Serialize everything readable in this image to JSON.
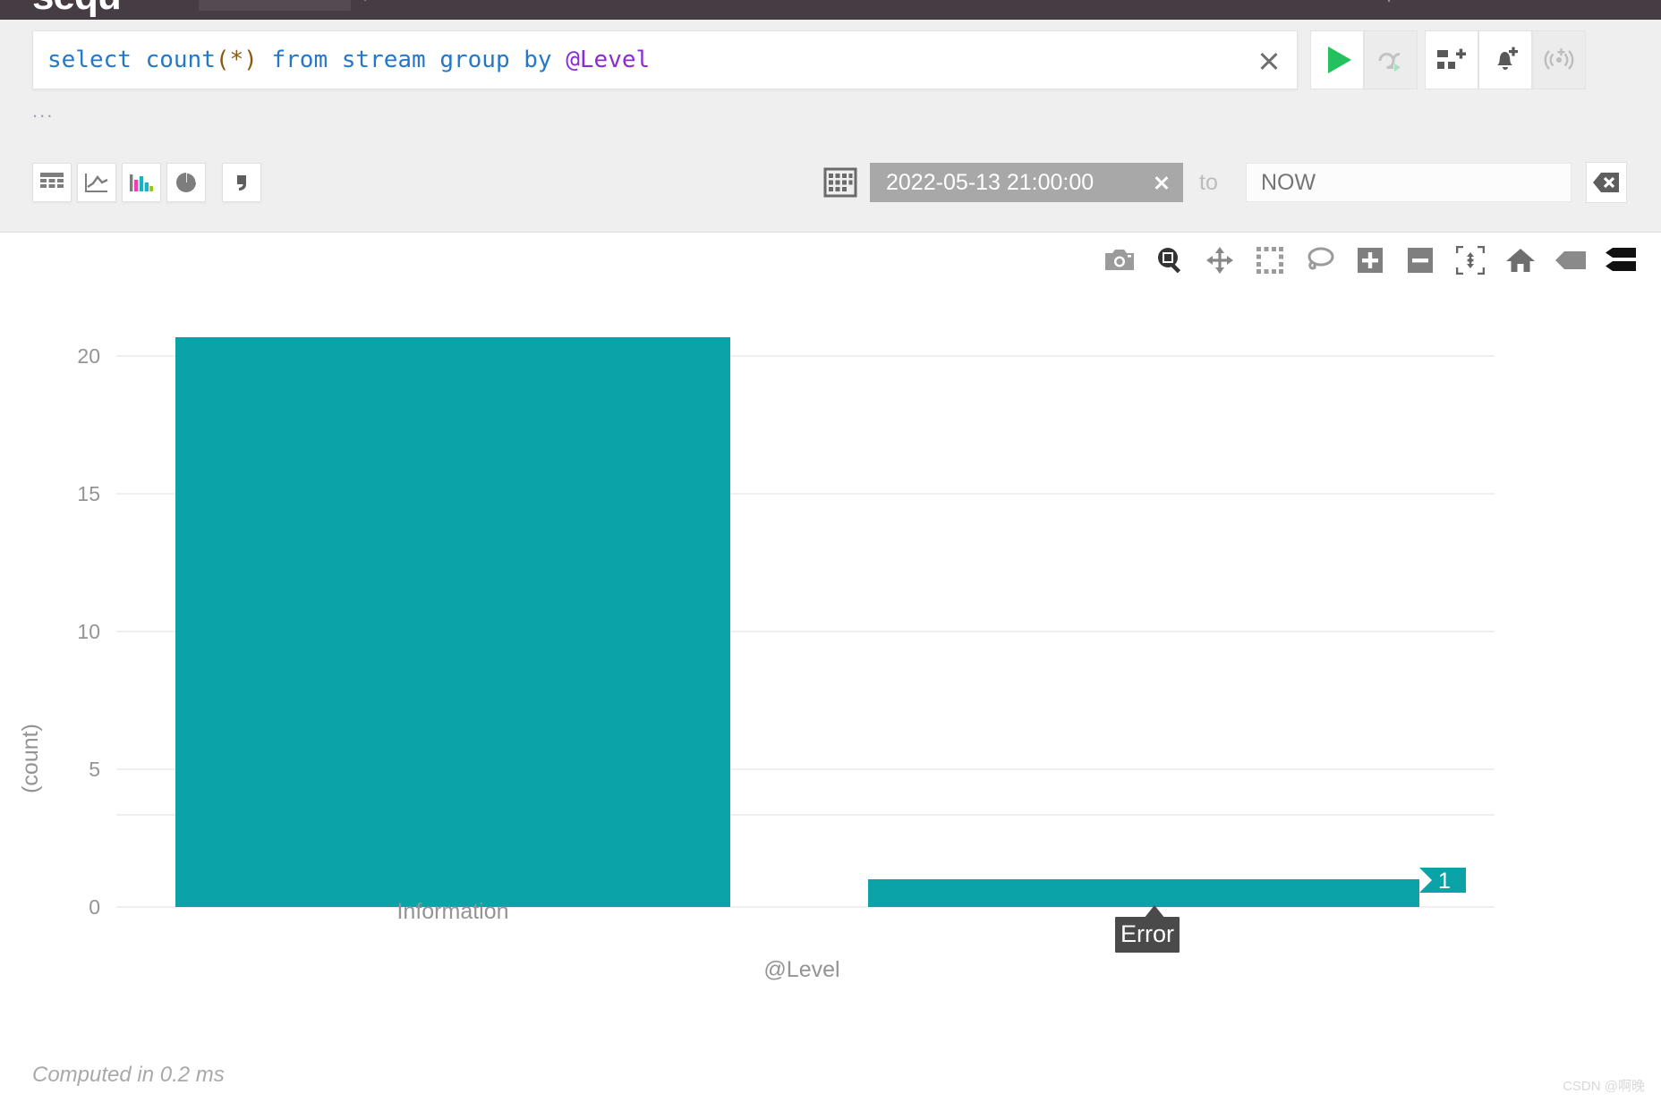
{
  "app": {
    "logo_text": "sequ",
    "top_bar_color": "#453c44",
    "accent_color": "#0ca3a8"
  },
  "query": {
    "full_text": "select count(*) from stream group by @Level",
    "tokens": {
      "select": "select",
      "count": "count",
      "paren_open": "(",
      "star": "*",
      "paren_close": ")",
      "from": "from",
      "stream": "stream",
      "group": "group",
      "by": "by",
      "level": "@Level"
    },
    "clear_icon": "close-icon",
    "ellipsis": "...",
    "buttons": [
      {
        "name": "run-query-button",
        "icon": "play-icon",
        "state": "enabled"
      },
      {
        "name": "live-tail-button",
        "icon": "repeat-play-icon",
        "state": "disabled"
      },
      {
        "name": "add-to-dashboard-button",
        "icon": "dashboard-add-icon",
        "state": "enabled"
      },
      {
        "name": "create-alert-button",
        "icon": "bell-add-icon",
        "state": "enabled"
      },
      {
        "name": "create-signal-button",
        "icon": "broadcast-add-icon",
        "state": "disabled"
      }
    ]
  },
  "viz_toolbar": {
    "items": [
      {
        "name": "view-table-button",
        "icon": "table-icon",
        "active": false
      },
      {
        "name": "view-line-chart-button",
        "icon": "line-chart-icon",
        "active": false
      },
      {
        "name": "view-bar-chart-button",
        "icon": "bar-chart-icon",
        "active": true
      },
      {
        "name": "view-pie-chart-button",
        "icon": "pie-chart-icon",
        "active": false
      },
      {
        "name": "view-raw-button",
        "icon": "comma-icon",
        "active": false
      }
    ]
  },
  "time_range": {
    "calendar_icon": "calendar-icon",
    "from_value": "2022-05-13 21:00:00",
    "from_clear_icon": "close-icon",
    "to_label": "to",
    "to_value": "",
    "to_placeholder": "NOW",
    "clear_all_icon": "backspace-icon"
  },
  "modebar": {
    "items": [
      {
        "name": "download-plot-button",
        "icon": "camera-icon",
        "active": false
      },
      {
        "name": "zoom-tool-button",
        "icon": "zoom-magnifier-icon",
        "active": true
      },
      {
        "name": "pan-tool-button",
        "icon": "pan-arrows-icon",
        "active": false
      },
      {
        "name": "box-select-button",
        "icon": "box-select-icon",
        "active": false
      },
      {
        "name": "lasso-select-button",
        "icon": "lasso-select-icon",
        "active": false
      },
      {
        "name": "zoom-in-button",
        "icon": "plus-icon",
        "active": false
      },
      {
        "name": "zoom-out-button",
        "icon": "minus-icon",
        "active": false
      },
      {
        "name": "autoscale-button",
        "icon": "autoscale-icon",
        "active": false
      },
      {
        "name": "reset-axes-button",
        "icon": "home-icon",
        "active": false
      },
      {
        "name": "toggle-spikelines-button",
        "icon": "spikeline-icon",
        "active": false
      },
      {
        "name": "compare-hover-button",
        "icon": "compare-data-icon",
        "active": true
      }
    ]
  },
  "chart_data": {
    "type": "bar",
    "title": "",
    "xlabel": "@Level",
    "ylabel": "(count)",
    "categories": [
      "Information",
      "Error"
    ],
    "values": [
      22,
      1
    ],
    "ylim": [
      0,
      22.6
    ],
    "yticks": [
      0,
      5,
      10,
      15,
      20
    ],
    "ytick_labels": [
      "0",
      "5",
      "10",
      "15",
      "20"
    ],
    "grid": true,
    "legend": "none",
    "bar_color": "#0ca3a8",
    "hover": {
      "category": "Error",
      "value_label": "1"
    }
  },
  "footer": {
    "compute_note": "Computed in 0.2 ms",
    "watermark": "CSDN @啊晚"
  }
}
